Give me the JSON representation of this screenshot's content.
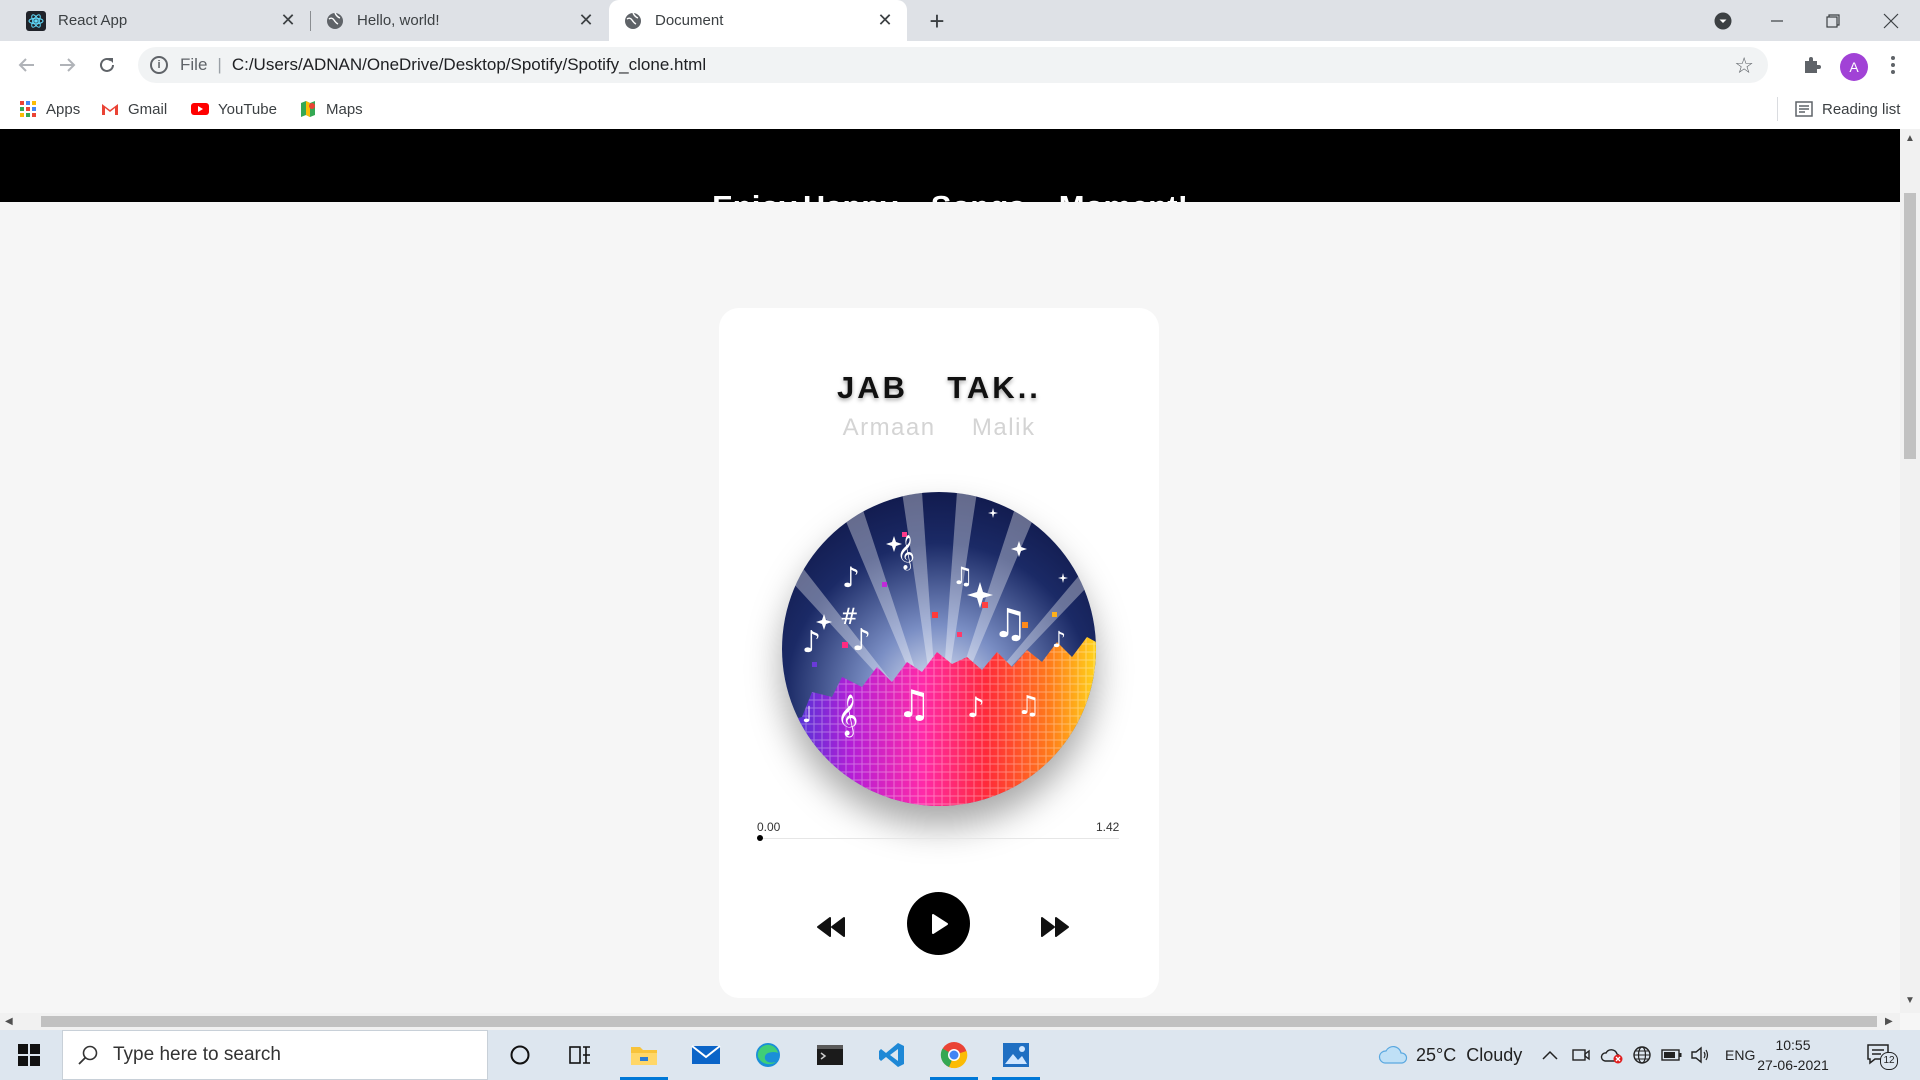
{
  "browser": {
    "tabs": [
      {
        "title": "React App",
        "icon": "react-icon",
        "active": false
      },
      {
        "title": "Hello, world!",
        "icon": "globe-icon",
        "active": false
      },
      {
        "title": "Document",
        "icon": "globe-icon",
        "active": true
      }
    ],
    "address": {
      "scheme_label": "File",
      "url": "C:/Users/ADNAN/OneDrive/Desktop/Spotify/Spotify_clone.html"
    },
    "profile_initial": "A",
    "bookmarks": [
      {
        "label": "Apps",
        "icon": "apps-grid-icon"
      },
      {
        "label": "Gmail",
        "icon": "gmail-icon"
      },
      {
        "label": "YouTube",
        "icon": "youtube-icon"
      },
      {
        "label": "Maps",
        "icon": "maps-icon"
      }
    ],
    "reading_list_label": "Reading list"
  },
  "page": {
    "header_title": "Enjoy,Happy  Songs  Moment!",
    "player": {
      "song_title": "JAB  TAK..",
      "artist": "Armaan  Malik",
      "current_time": "0.00",
      "duration": "1.42",
      "progress": 0
    }
  },
  "taskbar": {
    "search_placeholder": "Type here to search",
    "weather": "25°C  Cloudy",
    "language": "ENG",
    "time": "10:55",
    "date": "27-06-2021",
    "notification_count": "12"
  },
  "colors": {
    "header_bg": "#000000",
    "page_bg": "#f6f6f6",
    "taskbar_bg": "#dde6ef",
    "accent_blue": "#0078d7"
  }
}
